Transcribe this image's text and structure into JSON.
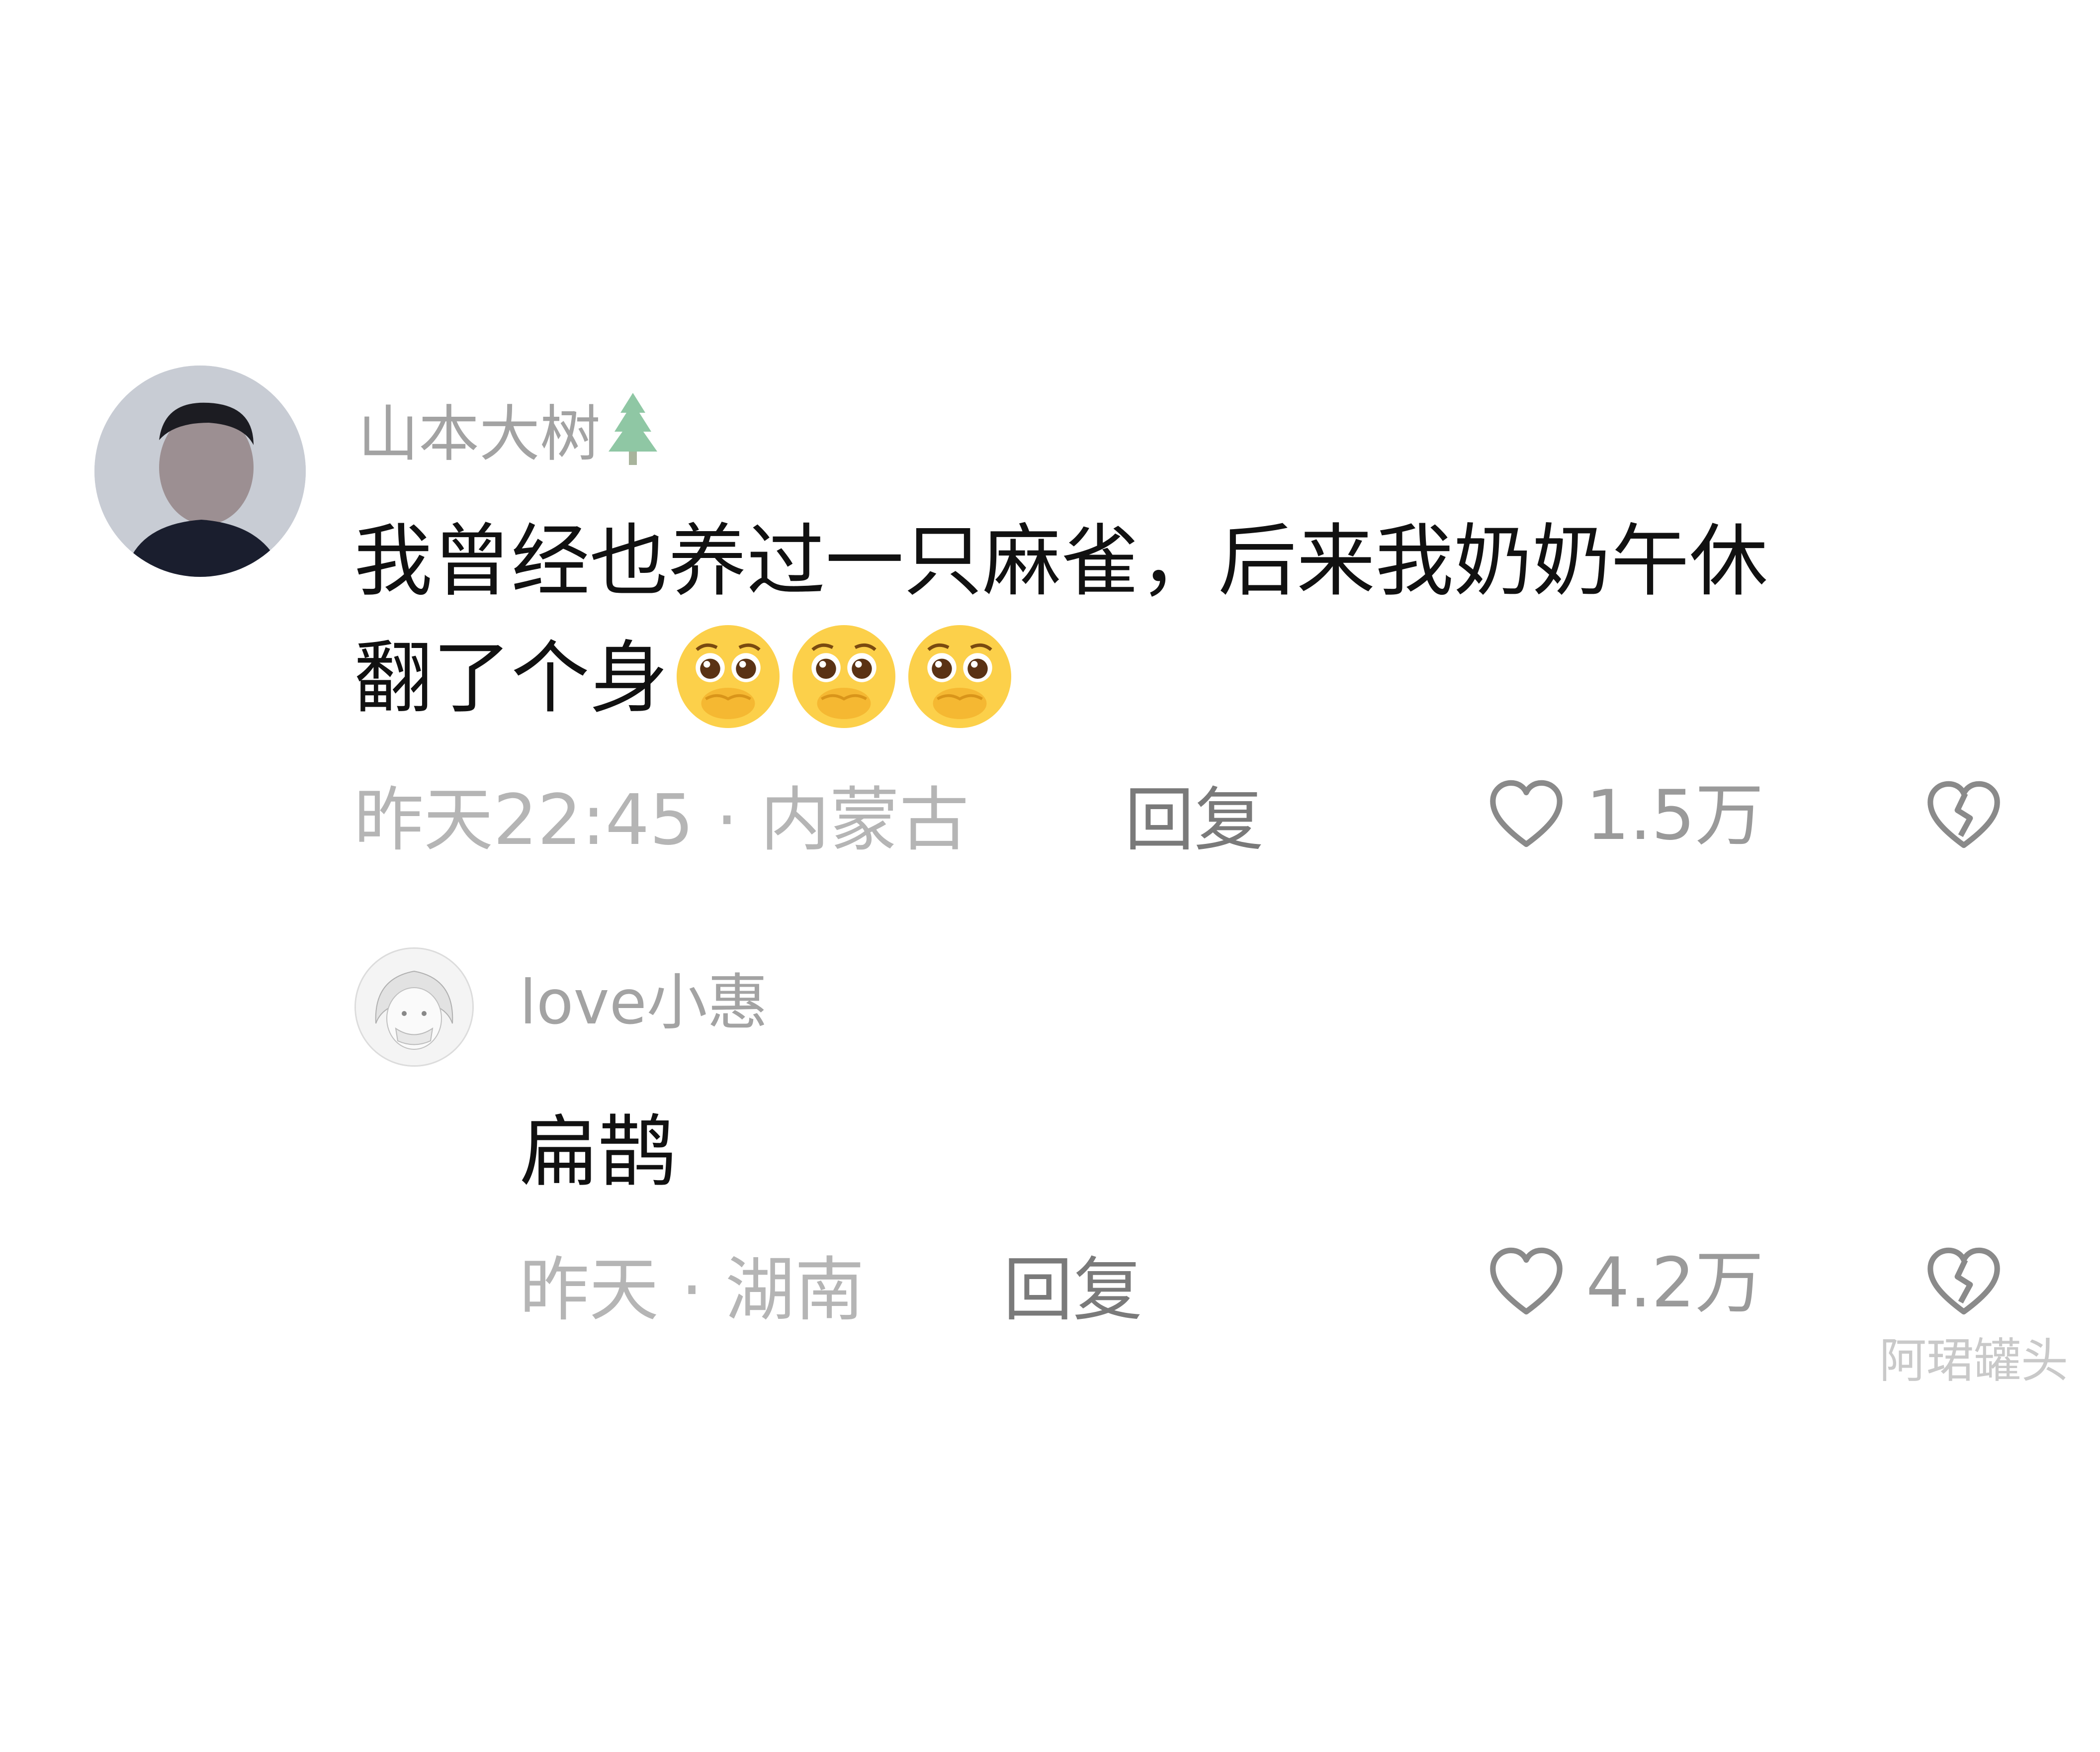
{
  "comment": {
    "username": "山本大树",
    "username_emoji": "tree-icon",
    "text_line1": "我曾经也养过一只麻雀，后来我奶奶午休",
    "text_line2": "翻了个身",
    "emoji_count": 3,
    "emoji_name": "pleading-face-covering-mouth",
    "meta": "昨天22:45 · 内蒙古",
    "reply_label": "回复",
    "likes": "1.5万"
  },
  "reply": {
    "username": "love小惠",
    "text": "扁鹊",
    "meta": "昨天 · 湖南",
    "reply_label": "回复",
    "likes": "4.2万"
  },
  "watermark": "阿珺罐头",
  "colors": {
    "background": "#ffffff",
    "text": "#111111",
    "username": "#a3a3a3",
    "meta": "#b5b5b5",
    "reply_label": "#7a7a7a",
    "icon": "#8a8a8a"
  }
}
